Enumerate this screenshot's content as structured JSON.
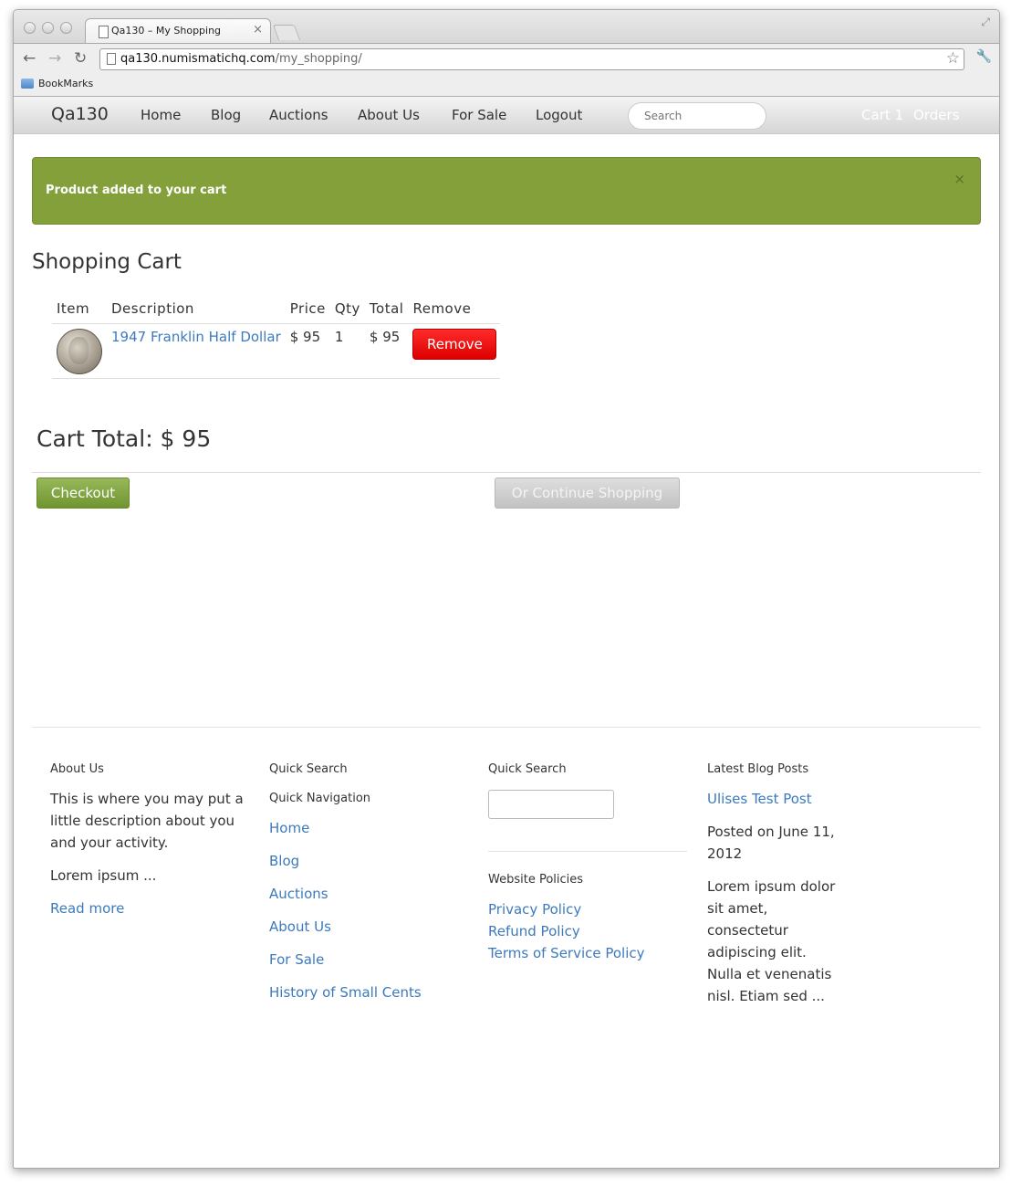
{
  "browser": {
    "tab_title": "Qa130 – My Shopping",
    "tab_close": "×",
    "url_domain": "qa130.numismatichq.com",
    "url_path": "/my_shopping/",
    "bookmarks_label": "BookMarks"
  },
  "nav": {
    "brand": "Qa130",
    "items": [
      "Home",
      "Blog",
      "Auctions",
      "About Us",
      "For Sale",
      "Logout"
    ],
    "search_placeholder": "Search",
    "cart": "Cart 1",
    "orders": "Orders"
  },
  "alert": {
    "message": "Product added to your cart",
    "close": "×",
    "color": "#83a03a"
  },
  "cart": {
    "title": "Shopping Cart",
    "headers": [
      "Item",
      "Description",
      "Price",
      "Qty",
      "Total",
      "Remove"
    ],
    "rows": [
      {
        "description": "1947 Franklin Half Dollar",
        "price": "$ 95",
        "qty": "1",
        "total": "$ 95",
        "remove_label": "Remove"
      }
    ],
    "total_label": "Cart Total: $ 95",
    "checkout_label": "Checkout",
    "continue_label": "Or Continue Shopping"
  },
  "footer": {
    "about": {
      "heading": "About Us",
      "text": "This is where you may put a little description about you and your activity.",
      "lorem": "Lorem ipsum ...",
      "read_more": "Read more"
    },
    "quicknav": {
      "heading1": "Quick Search",
      "heading2": "Quick Navigation",
      "links": [
        "Home",
        "Blog",
        "Auctions",
        "About Us",
        "For Sale",
        "History of Small Cents"
      ]
    },
    "search": {
      "heading": "Quick Search",
      "policies_heading": "Website Policies",
      "policies": [
        "Privacy Policy",
        "Refund Policy",
        "Terms of Service Policy"
      ]
    },
    "blog": {
      "heading": "Latest Blog Posts",
      "post_title": "Ulises Test Post",
      "posted": "Posted on June 11, 2012",
      "excerpt": "Lorem ipsum dolor sit amet, consectetur adipiscing elit. Nulla et venenatis nisl. Etiam sed ..."
    }
  }
}
